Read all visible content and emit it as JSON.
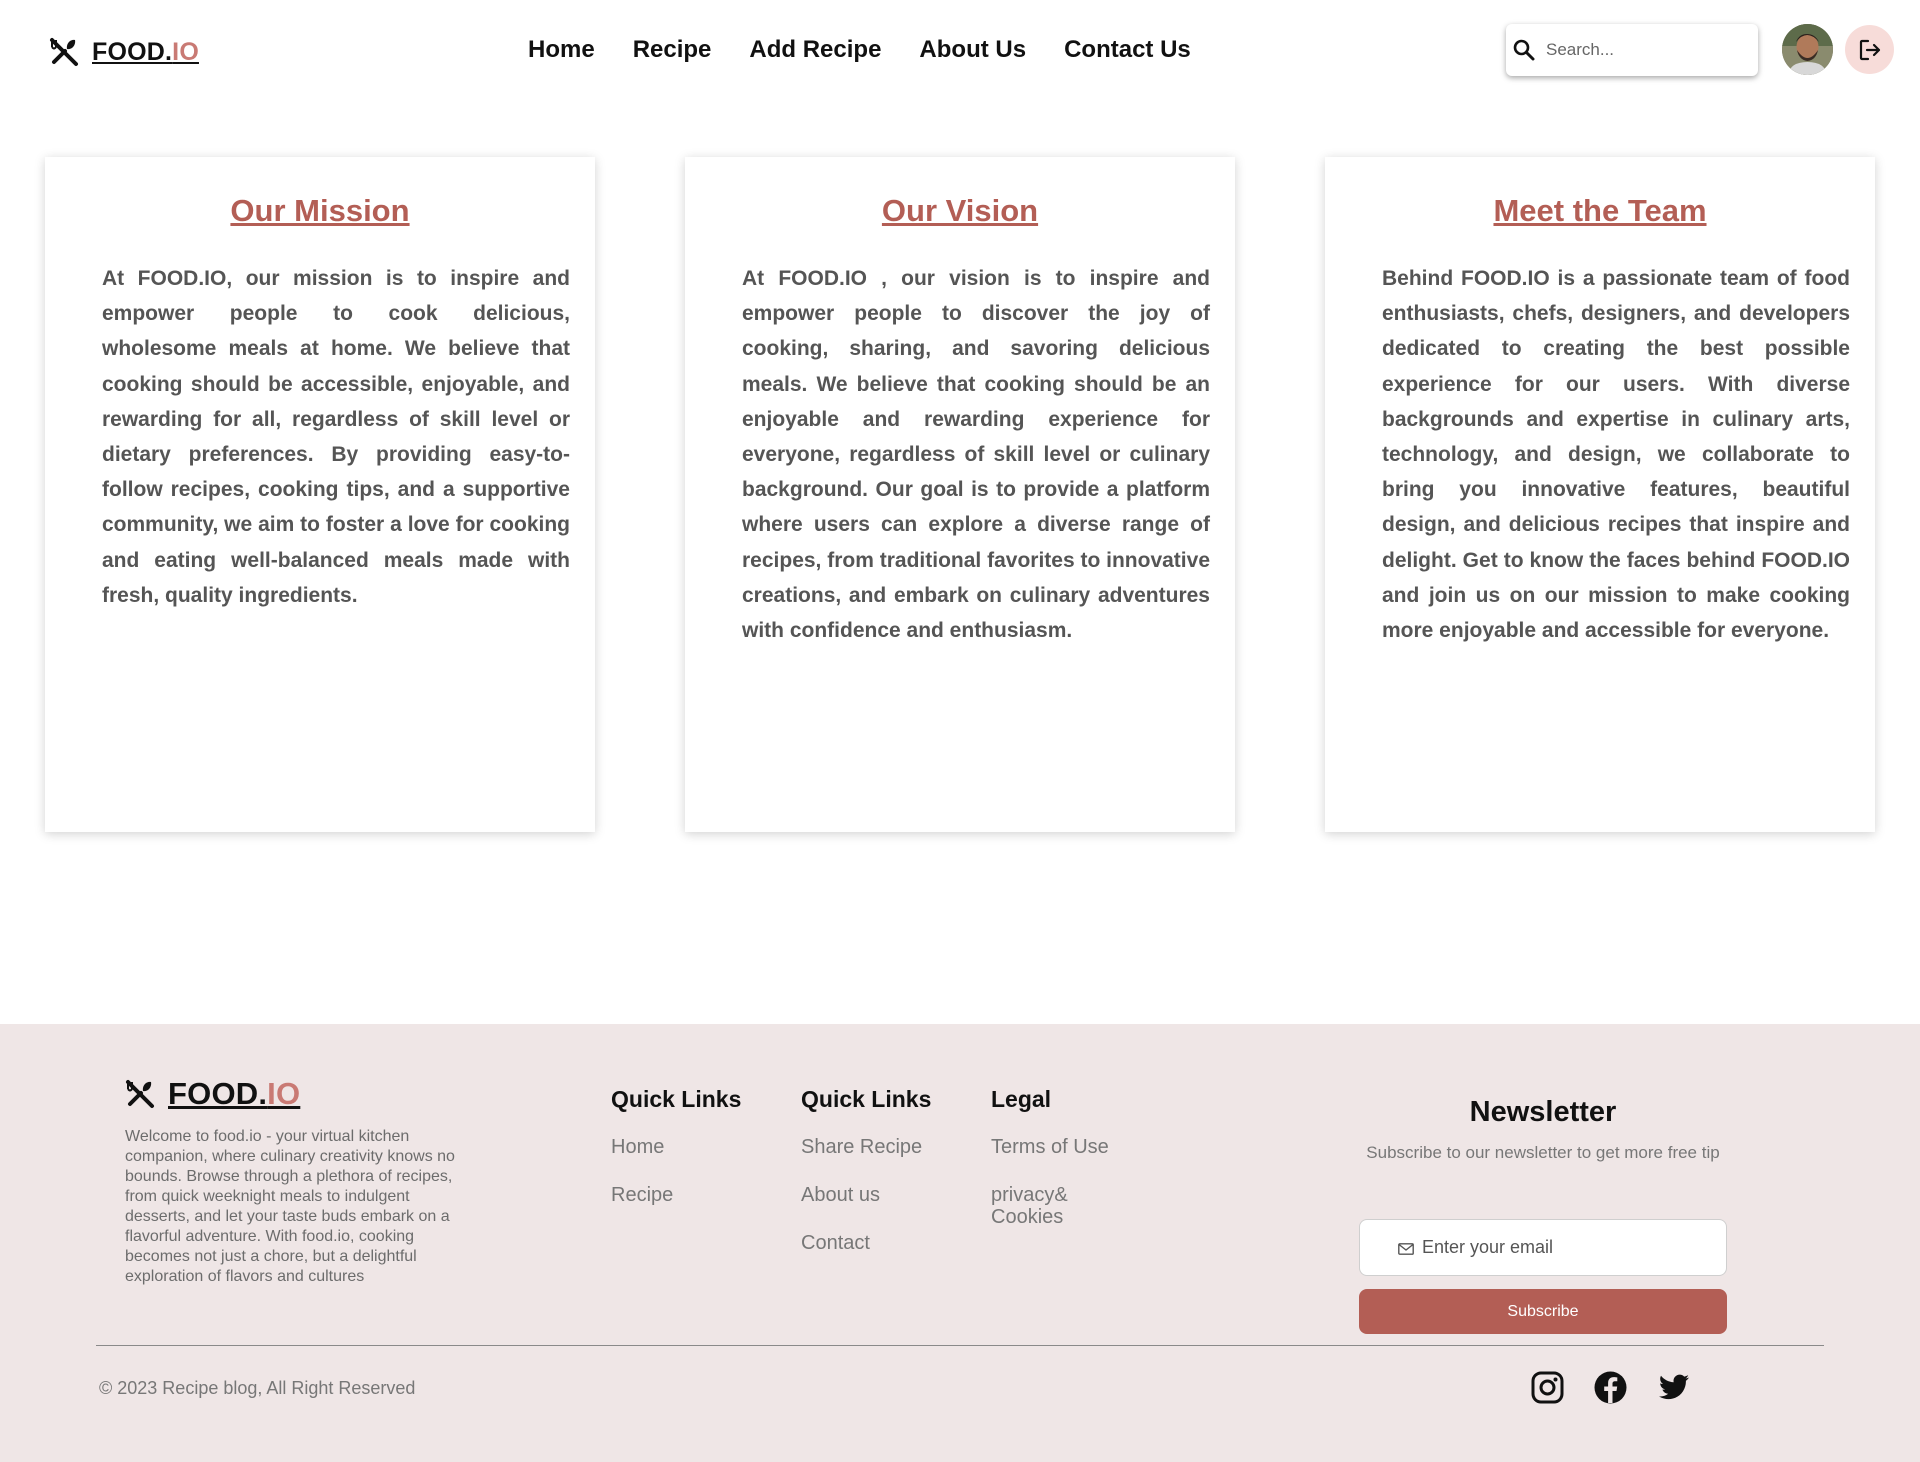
{
  "brand": {
    "name_main": "FOOD.",
    "name_accent": "IO"
  },
  "nav": {
    "items": [
      {
        "label": "Home"
      },
      {
        "label": "Recipe"
      },
      {
        "label": "Add Recipe"
      },
      {
        "label": "About Us"
      },
      {
        "label": "Contact Us"
      }
    ]
  },
  "search": {
    "placeholder": "Search..."
  },
  "header_icons": {
    "search": "search-icon",
    "avatar": "user-avatar",
    "logout": "logout-icon"
  },
  "cards": [
    {
      "title": "Our Mission",
      "text": "At FOOD.IO, our mission is to inspire and empower people to cook delicious, wholesome meals at home. We believe that cooking should be accessible, enjoyable, and rewarding for all, regardless of skill level or dietary preferences. By providing easy-to-follow recipes, cooking tips, and a supportive community, we aim to foster a love for cooking and eating well-balanced meals made with fresh, quality ingredients."
    },
    {
      "title": "Our Vision",
      "text": "At FOOD.IO , our vision is to inspire and empower people to discover the joy of cooking, sharing, and savoring delicious meals. We believe that cooking should be an enjoyable and rewarding experience for everyone, regardless of skill level or culinary background. Our goal is to provide a platform where users can explore a diverse range of recipes, from traditional favorites to innovative creations, and embark on culinary adventures with confidence and enthusiasm."
    },
    {
      "title": "Meet the Team",
      "text": "Behind FOOD.IO is a passionate team of food enthusiasts, chefs, designers, and developers dedicated to creating the best possible experience for our users. With diverse backgrounds and expertise in culinary arts, technology, and design, we collaborate to bring you innovative features, beautiful design, and delicious recipes that inspire and delight. Get to know the faces behind FOOD.IO and join us on our mission to make cooking more enjoyable and accessible for everyone."
    }
  ],
  "footer": {
    "description": "Welcome to food.io - your virtual kitchen companion, where culinary creativity knows no bounds. Browse through a plethora of recipes, from quick weeknight meals to indulgent desserts, and let your taste buds embark on a flavorful adventure. With food.io, cooking becomes not just a chore, but a delightful exploration of flavors and cultures",
    "columns": [
      {
        "title": "Quick Links",
        "links": [
          "Home",
          "Recipe"
        ]
      },
      {
        "title": "Quick Links",
        "links": [
          "Share Recipe",
          "About us",
          "Contact"
        ]
      },
      {
        "title": "Legal",
        "links": [
          "Terms of Use",
          "privacy& Cookies"
        ]
      }
    ],
    "newsletter": {
      "title": "Newsletter",
      "subtitle": "Subscribe to our newsletter to get more free tip",
      "email_placeholder": "Enter your email",
      "button_label": "Subscribe"
    },
    "copyright": "© 2023 Recipe blog, All Right Reserved",
    "social_icons": [
      "instagram-icon",
      "facebook-icon",
      "twitter-icon"
    ]
  },
  "colors": {
    "accent": "#b35e55",
    "logo_accent": "#c97a74",
    "footer_bg": "#efe6e6",
    "logout_bg": "#f7dcd9"
  }
}
